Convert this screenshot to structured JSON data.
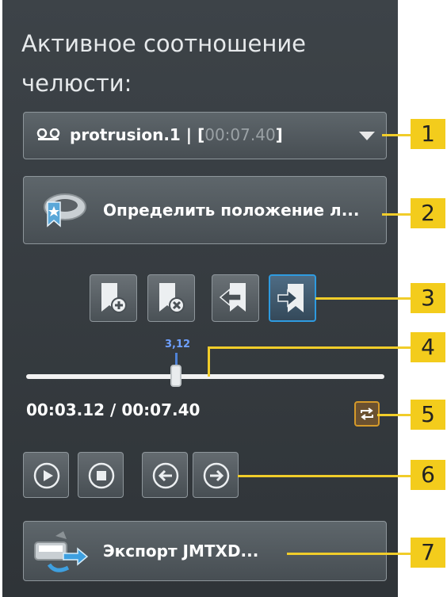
{
  "panel": {
    "title": "Активное соотношение челюсти:"
  },
  "dropdown": {
    "icon": "tape-recording-icon",
    "selected_name": "protrusion.1 | [",
    "selected_time": "00:07.40",
    "selected_suffix": "]"
  },
  "define_button": {
    "icon": "jaw-bookmark-icon",
    "label": "Определить положение л..."
  },
  "bookmark_buttons": [
    {
      "name": "add-bookmark-icon"
    },
    {
      "name": "remove-bookmark-icon"
    },
    {
      "name": "previous-bookmark-icon"
    },
    {
      "name": "next-bookmark-icon",
      "active": true
    }
  ],
  "slider": {
    "value_label": "3,12",
    "position_fraction": 0.42
  },
  "timer": {
    "text": "00:03.12 / 00:07.40"
  },
  "loop_button": {
    "icon": "loop-icon"
  },
  "playback": [
    {
      "name": "play-icon"
    },
    {
      "name": "stop-icon"
    },
    {
      "name": "step-back-icon"
    },
    {
      "name": "step-forward-icon"
    }
  ],
  "export_button": {
    "icon": "export-icon",
    "label": "Экспорт JMTXD..."
  },
  "callouts": [
    "1",
    "2",
    "3",
    "4",
    "5",
    "6",
    "7"
  ],
  "colors": {
    "panel": "#363c41",
    "accent_blue": "#2e9be0",
    "loop_orange": "#d59a2a",
    "callout_yellow": "#f3cc1c"
  }
}
